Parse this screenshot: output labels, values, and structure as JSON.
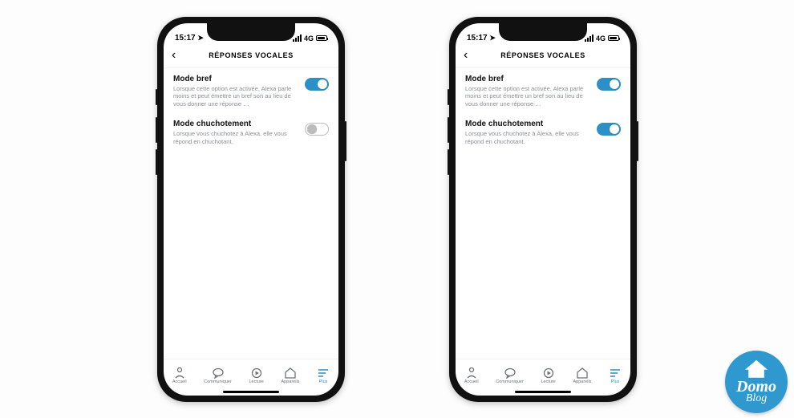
{
  "status": {
    "time": "15:17",
    "network": "4G"
  },
  "nav": {
    "title": "RÉPONSES VOCALES"
  },
  "settings": {
    "mode_bref": {
      "title": "Mode bref",
      "desc": "Lorsque cette option est activée, Alexa parle moins et peut émettre un bref son au lieu de vous donner une réponse …"
    },
    "mode_chuchotement": {
      "title": "Mode chuchotement",
      "desc": "Lorsque vous chuchotez à Alexa, elle vous répond en chuchotant."
    }
  },
  "phones": [
    {
      "mode_bref_on": true,
      "mode_chuchotement_on": false
    },
    {
      "mode_bref_on": true,
      "mode_chuchotement_on": true
    }
  ],
  "tabs": {
    "accueil": "Accueil",
    "communiquer": "Communiquer",
    "lecture": "Lecture",
    "appareils": "Appareils",
    "plus": "Plus"
  },
  "watermark": {
    "line1": "Domo",
    "line2": "Blog"
  },
  "colors": {
    "accent": "#2c8fc6"
  }
}
